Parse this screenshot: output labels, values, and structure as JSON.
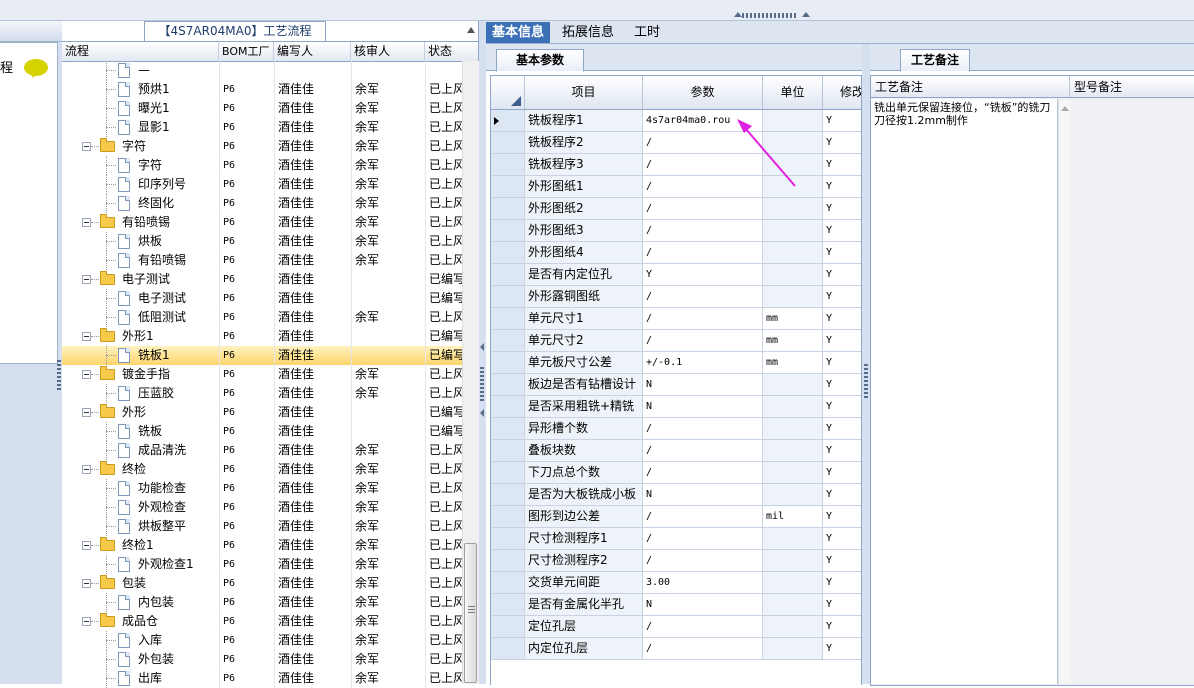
{
  "tree_panel": {
    "title": "【4S7AR04MA0】工艺流程",
    "left_label": "程",
    "columns": [
      "流程",
      "BOM工厂",
      "编写人",
      "核审人",
      "状态"
    ],
    "rows": [
      {
        "level": 2,
        "type": "doc",
        "name": "—",
        "factory": "",
        "writer": "",
        "reviewer": "",
        "status": ""
      },
      {
        "level": 2,
        "type": "doc",
        "name": "预烘1",
        "factory": "P6",
        "writer": "酒佳佳",
        "reviewer": "余军",
        "status": "已上风"
      },
      {
        "level": 2,
        "type": "doc",
        "name": "曝光1",
        "factory": "P6",
        "writer": "酒佳佳",
        "reviewer": "余军",
        "status": "已上风"
      },
      {
        "level": 2,
        "type": "doc",
        "name": "显影1",
        "factory": "P6",
        "writer": "酒佳佳",
        "reviewer": "余军",
        "status": "已上风"
      },
      {
        "level": 1,
        "type": "folder",
        "name": "字符",
        "factory": "P6",
        "writer": "酒佳佳",
        "reviewer": "余军",
        "status": "已上风"
      },
      {
        "level": 2,
        "type": "doc",
        "name": "字符",
        "factory": "P6",
        "writer": "酒佳佳",
        "reviewer": "余军",
        "status": "已上风"
      },
      {
        "level": 2,
        "type": "doc",
        "name": "印序列号",
        "factory": "P6",
        "writer": "酒佳佳",
        "reviewer": "余军",
        "status": "已上风"
      },
      {
        "level": 2,
        "type": "doc",
        "name": "终固化",
        "factory": "P6",
        "writer": "酒佳佳",
        "reviewer": "余军",
        "status": "已上风"
      },
      {
        "level": 1,
        "type": "folder",
        "name": "有铅喷锡",
        "factory": "P6",
        "writer": "酒佳佳",
        "reviewer": "余军",
        "status": "已上风"
      },
      {
        "level": 2,
        "type": "doc",
        "name": "烘板",
        "factory": "P6",
        "writer": "酒佳佳",
        "reviewer": "余军",
        "status": "已上风"
      },
      {
        "level": 2,
        "type": "doc",
        "name": "有铅喷锡",
        "factory": "P6",
        "writer": "酒佳佳",
        "reviewer": "余军",
        "status": "已上风"
      },
      {
        "level": 1,
        "type": "folder",
        "name": "电子测试",
        "factory": "P6",
        "writer": "酒佳佳",
        "reviewer": "",
        "status": "已编写"
      },
      {
        "level": 2,
        "type": "doc",
        "name": "电子测试",
        "factory": "P6",
        "writer": "酒佳佳",
        "reviewer": "",
        "status": "已编写"
      },
      {
        "level": 2,
        "type": "doc",
        "name": "低阻测试",
        "factory": "P6",
        "writer": "酒佳佳",
        "reviewer": "余军",
        "status": "已上风"
      },
      {
        "level": 1,
        "type": "folder",
        "name": "外形1",
        "factory": "P6",
        "writer": "酒佳佳",
        "reviewer": "",
        "status": "已编写"
      },
      {
        "level": 2,
        "type": "doc",
        "name": "铣板1",
        "factory": "P6",
        "writer": "酒佳佳",
        "reviewer": "",
        "status": "已编写",
        "selected": true
      },
      {
        "level": 1,
        "type": "folder",
        "name": "镀金手指",
        "factory": "P6",
        "writer": "酒佳佳",
        "reviewer": "余军",
        "status": "已上风"
      },
      {
        "level": 2,
        "type": "doc",
        "name": "压蓝胶",
        "factory": "P6",
        "writer": "酒佳佳",
        "reviewer": "余军",
        "status": "已上风"
      },
      {
        "level": 1,
        "type": "folder",
        "name": "外形",
        "factory": "P6",
        "writer": "酒佳佳",
        "reviewer": "",
        "status": "已编写"
      },
      {
        "level": 2,
        "type": "doc",
        "name": "铣板",
        "factory": "P6",
        "writer": "酒佳佳",
        "reviewer": "",
        "status": "已编写"
      },
      {
        "level": 2,
        "type": "doc",
        "name": "成品清洗",
        "factory": "P6",
        "writer": "酒佳佳",
        "reviewer": "余军",
        "status": "已上风"
      },
      {
        "level": 1,
        "type": "folder",
        "name": "终检",
        "factory": "P6",
        "writer": "酒佳佳",
        "reviewer": "余军",
        "status": "已上风"
      },
      {
        "level": 2,
        "type": "doc",
        "name": "功能检查",
        "factory": "P6",
        "writer": "酒佳佳",
        "reviewer": "余军",
        "status": "已上风"
      },
      {
        "level": 2,
        "type": "doc",
        "name": "外观检查",
        "factory": "P6",
        "writer": "酒佳佳",
        "reviewer": "余军",
        "status": "已上风"
      },
      {
        "level": 2,
        "type": "doc",
        "name": "烘板整平",
        "factory": "P6",
        "writer": "酒佳佳",
        "reviewer": "余军",
        "status": "已上风"
      },
      {
        "level": 1,
        "type": "folder",
        "name": "终检1",
        "factory": "P6",
        "writer": "酒佳佳",
        "reviewer": "余军",
        "status": "已上风"
      },
      {
        "level": 2,
        "type": "doc",
        "name": "外观检查1",
        "factory": "P6",
        "writer": "酒佳佳",
        "reviewer": "余军",
        "status": "已上风"
      },
      {
        "level": 1,
        "type": "folder",
        "name": "包装",
        "factory": "P6",
        "writer": "酒佳佳",
        "reviewer": "余军",
        "status": "已上风"
      },
      {
        "level": 2,
        "type": "doc",
        "name": "内包装",
        "factory": "P6",
        "writer": "酒佳佳",
        "reviewer": "余军",
        "status": "已上风"
      },
      {
        "level": 1,
        "type": "folder",
        "name": "成品仓",
        "factory": "P6",
        "writer": "酒佳佳",
        "reviewer": "余军",
        "status": "已上风"
      },
      {
        "level": 2,
        "type": "doc",
        "name": "入库",
        "factory": "P6",
        "writer": "酒佳佳",
        "reviewer": "余军",
        "status": "已上风"
      },
      {
        "level": 2,
        "type": "doc",
        "name": "外包装",
        "factory": "P6",
        "writer": "酒佳佳",
        "reviewer": "余军",
        "status": "已上风"
      },
      {
        "level": 2,
        "type": "doc",
        "name": "出库",
        "factory": "P6",
        "writer": "酒佳佳",
        "reviewer": "余军",
        "status": "已上风"
      }
    ]
  },
  "main_tabs": [
    "基本信息",
    "拓展信息",
    "工时"
  ],
  "active_tab": "基本信息",
  "params_panel": {
    "subtab": "基本参数",
    "columns": [
      "项目",
      "参数",
      "单位",
      "修改"
    ],
    "rows": [
      {
        "item": "铣板程序1",
        "value": "4s7ar04ma0.rou",
        "unit": "",
        "mod": "Y",
        "current": true
      },
      {
        "item": "铣板程序2",
        "value": "/",
        "unit": "",
        "mod": "Y"
      },
      {
        "item": "铣板程序3",
        "value": "/",
        "unit": "",
        "mod": "Y"
      },
      {
        "item": "外形图纸1",
        "value": "/",
        "unit": "",
        "mod": "Y"
      },
      {
        "item": "外形图纸2",
        "value": "/",
        "unit": "",
        "mod": "Y"
      },
      {
        "item": "外形图纸3",
        "value": "/",
        "unit": "",
        "mod": "Y"
      },
      {
        "item": "外形图纸4",
        "value": "/",
        "unit": "",
        "mod": "Y"
      },
      {
        "item": "是否有内定位孔",
        "value": "Y",
        "unit": "",
        "mod": "Y"
      },
      {
        "item": "外形露铜图纸",
        "value": "/",
        "unit": "",
        "mod": "Y"
      },
      {
        "item": "单元尺寸1",
        "value": "/",
        "unit": "mm",
        "mod": "Y"
      },
      {
        "item": "单元尺寸2",
        "value": "/",
        "unit": "mm",
        "mod": "Y"
      },
      {
        "item": "单元板尺寸公差",
        "value": "+/-0.1",
        "unit": "mm",
        "mod": "Y"
      },
      {
        "item": "板边是否有钻槽设计",
        "value": "N",
        "unit": "",
        "mod": "Y"
      },
      {
        "item": "是否采用粗铣+精铣",
        "value": "N",
        "unit": "",
        "mod": "Y"
      },
      {
        "item": "异形槽个数",
        "value": "/",
        "unit": "",
        "mod": "Y"
      },
      {
        "item": "叠板块数",
        "value": "/",
        "unit": "",
        "mod": "Y"
      },
      {
        "item": "下刀点总个数",
        "value": "/",
        "unit": "",
        "mod": "Y"
      },
      {
        "item": "是否为大板铣成小板",
        "value": "N",
        "unit": "",
        "mod": "Y"
      },
      {
        "item": "图形到边公差",
        "value": "/",
        "unit": "mil",
        "mod": "Y"
      },
      {
        "item": "尺寸检测程序1",
        "value": "/",
        "unit": "",
        "mod": "Y"
      },
      {
        "item": "尺寸检测程序2",
        "value": "/",
        "unit": "",
        "mod": "Y"
      },
      {
        "item": "交货单元间距",
        "value": "3.00",
        "unit": "",
        "mod": "Y"
      },
      {
        "item": "是否有金属化半孔",
        "value": "N",
        "unit": "",
        "mod": "Y"
      },
      {
        "item": "定位孔层",
        "value": "/",
        "unit": "",
        "mod": "Y"
      },
      {
        "item": "内定位孔层",
        "value": "/",
        "unit": "",
        "mod": "Y"
      }
    ]
  },
  "notes_panel": {
    "subtab": "工艺备注",
    "col1": "工艺备注",
    "col2": "型号备注",
    "note_text": "铣出单元保留连接位，“铣板”的铣刀刀径按1.2mm制作"
  },
  "colors": {
    "tab_active": "#3b6fb6",
    "selection": "#fdd56b",
    "annotation_arrow": "#e020e0",
    "folder": "#f7c94a"
  }
}
